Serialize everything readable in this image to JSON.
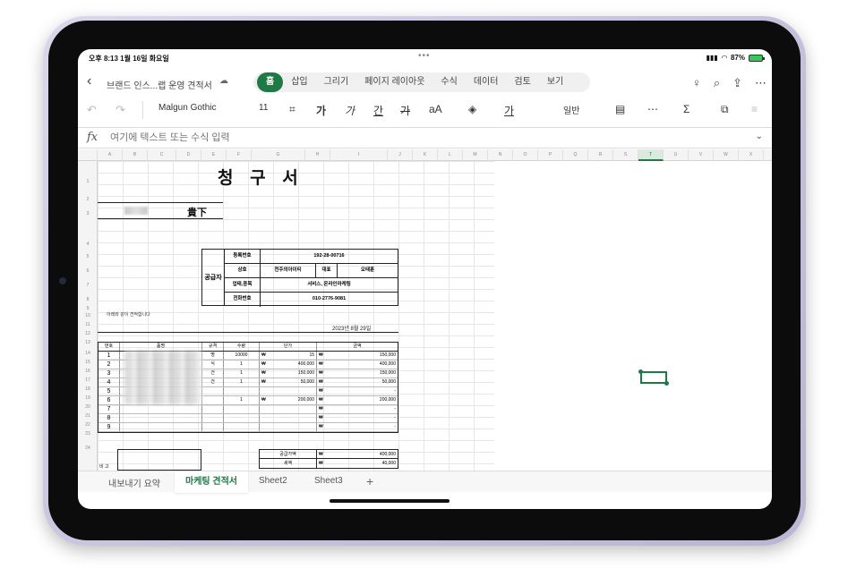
{
  "status": {
    "time": "오후 8:13  1월 16일 화요일",
    "dots": "•••",
    "battery": "87%"
  },
  "ribbon": {
    "back_icon": "chevron-left-icon",
    "doc_title": "브랜드 인스...랩 운영 견적서",
    "tabs": [
      "홈",
      "삽입",
      "그리기",
      "페이지 레이아웃",
      "수식",
      "데이터",
      "검토",
      "보기"
    ],
    "right_icons": [
      "lightbulb-icon",
      "search-icon",
      "share-icon",
      "more-icon"
    ]
  },
  "toolbar": {
    "undo_icon": "undo-icon",
    "redo_icon": "redo-icon",
    "font_name": "Malgun Gothic",
    "font_size": "11",
    "bold_label": "가",
    "italic_label": "가",
    "underline_label": "간",
    "strike_label": "가",
    "fontsize_label": "aA",
    "number_format": "일반",
    "sum_label": "Σ"
  },
  "formula": {
    "fx": "fx",
    "placeholder": "여기에 텍스트 또는 수식 입력"
  },
  "grid": {
    "columns": [
      "A",
      "B",
      "C",
      "D",
      "E",
      "F",
      "G",
      "H",
      "I",
      "J",
      "K",
      "L",
      "M",
      "N",
      "O",
      "P",
      "Q",
      "R",
      "S",
      "T",
      "U",
      "V",
      "W",
      "X"
    ],
    "selected_column": "T",
    "rows": [
      "1",
      "2",
      "3",
      "4",
      "5",
      "6",
      "7",
      "8",
      "9",
      "10",
      "11",
      "12",
      "13",
      "14",
      "15",
      "16",
      "17",
      "18",
      "19",
      "20",
      "21",
      "22",
      "23",
      "24"
    ]
  },
  "invoice": {
    "title": "청 구 서",
    "addressee_suffix": "貴下",
    "supplier_side": "공급자",
    "supplier": {
      "reg_label": "등록번호",
      "reg_value": "192-28-00716",
      "name_label": "상호",
      "name_value": "천주의아이티",
      "rep_label": "대표",
      "rep_value": "오태훈",
      "biz_label": "업태,종목",
      "biz_value": "서비스, 온라인마케팅",
      "phone_label": "전화번호",
      "phone_value": "010-2776-9081"
    },
    "note": "아래와 같이 견적합니다",
    "date": "2023년 8월 29일",
    "headers": [
      "번호",
      "품명",
      "규격",
      "수량",
      "단가",
      "금액"
    ],
    "items": [
      {
        "no": "1",
        "spec": "명",
        "qty": "10000",
        "cur1": "₩",
        "price": "15",
        "cur2": "₩",
        "amount": "150,000"
      },
      {
        "no": "2",
        "spec": "식",
        "qty": "1",
        "cur1": "₩",
        "price": "400,000",
        "cur2": "₩",
        "amount": "400,000"
      },
      {
        "no": "3",
        "spec": "건",
        "qty": "1",
        "cur1": "₩",
        "price": "150,000",
        "cur2": "₩",
        "amount": "150,000"
      },
      {
        "no": "4",
        "spec": "건",
        "qty": "1",
        "cur1": "₩",
        "price": "50,000",
        "cur2": "₩",
        "amount": "50,000"
      },
      {
        "no": "5",
        "spec": "",
        "qty": "",
        "cur1": "",
        "price": "",
        "cur2": "₩",
        "amount": "-"
      },
      {
        "no": "6",
        "spec": "",
        "qty": "1",
        "cur1": "₩",
        "price": "200,000",
        "cur2": "₩",
        "amount": "200,000"
      },
      {
        "no": "7",
        "spec": "",
        "qty": "",
        "cur1": "",
        "price": "",
        "cur2": "₩",
        "amount": "-"
      },
      {
        "no": "8",
        "spec": "",
        "qty": "",
        "cur1": "",
        "price": "",
        "cur2": "₩",
        "amount": "-"
      },
      {
        "no": "9",
        "spec": "",
        "qty": "",
        "cur1": "",
        "price": "",
        "cur2": "₩",
        "amount": "-"
      }
    ],
    "supply_label": "공급가액",
    "supply_cur": "₩",
    "supply_value": "400,000",
    "tax_label": "세액",
    "tax_cur": "₩",
    "tax_value": "40,000",
    "remark_label": "비 고"
  },
  "sheet_tabs": {
    "tabs": [
      "내보내기 요약",
      "마케팅 견적서",
      "Sheet2",
      "Sheet3"
    ],
    "active": "마케팅 견적서",
    "add_label": "+"
  }
}
